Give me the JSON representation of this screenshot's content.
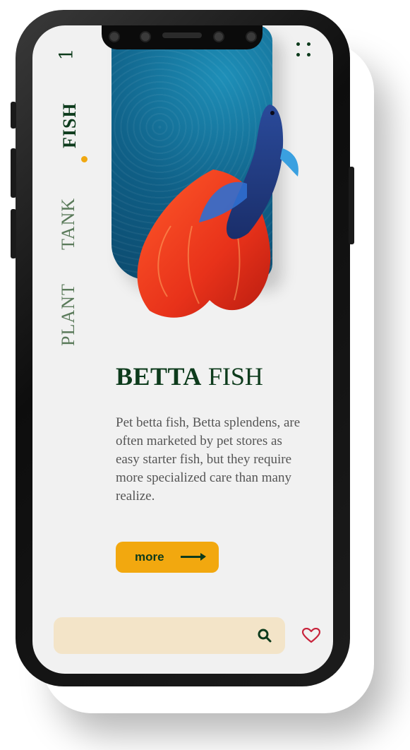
{
  "nav": {
    "page_number": "1",
    "items": [
      {
        "label": "FISH",
        "active": true
      },
      {
        "label": "TANK",
        "active": false
      },
      {
        "label": "PLANT",
        "active": false
      }
    ]
  },
  "hero": {
    "icon": "betta-fish-image"
  },
  "product": {
    "title_bold": "BETTA",
    "title_regular": "FISH",
    "description": "Pet betta fish, Betta splendens, are often marketed by pet stores as easy starter fish, but they require more specialized care than many realize."
  },
  "cta": {
    "label": "more"
  },
  "search": {
    "value": "",
    "placeholder": ""
  },
  "colors": {
    "accent": "#f2a80f",
    "brand_green": "#0d3b1c",
    "search_bg": "#f3e4c8",
    "heart": "#c8243c"
  }
}
